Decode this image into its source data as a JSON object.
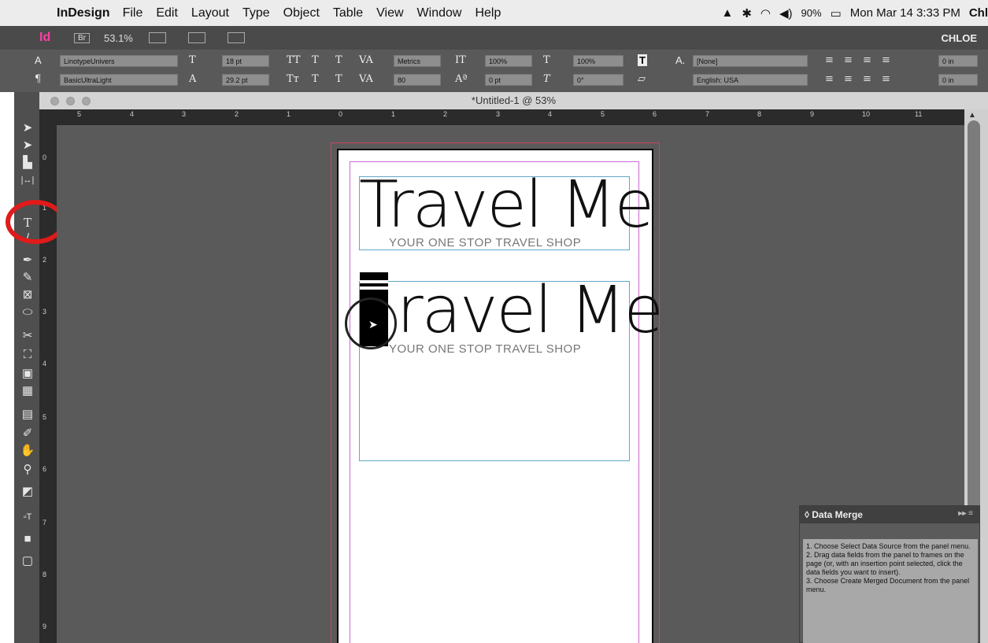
{
  "menubar": {
    "app": "InDesign",
    "items": [
      "File",
      "Edit",
      "Layout",
      "Type",
      "Object",
      "Table",
      "View",
      "Window",
      "Help"
    ],
    "battery": "90%",
    "clock": "Mon Mar 14  3:33 PM",
    "user_trunc": "Chl"
  },
  "appbar": {
    "logo": "Id",
    "bridge": "Br",
    "zoom": "53.1%",
    "user": "CHLOE"
  },
  "control": {
    "font_family": "LinotypeUnivers",
    "font_style": "BasicUltraLight",
    "font_size": "18 pt",
    "leading": "29.2 pt",
    "kerning": "Metrics",
    "tracking": "80",
    "vscale": "100%",
    "hscale": "100%",
    "baseline": "0 pt",
    "skew": "0°",
    "char_style": "[None]",
    "language": "English: USA",
    "indent_left": "0 in",
    "indent_first": "0 in"
  },
  "document": {
    "title": "*Untitled-1 @ 53%"
  },
  "ruler": {
    "h_numbers": [
      "5",
      "4",
      "3",
      "2",
      "1",
      "0",
      "1",
      "2",
      "3",
      "4",
      "5",
      "6",
      "7",
      "8",
      "9",
      "10",
      "11"
    ],
    "v_numbers": [
      "0",
      "1",
      "2",
      "3",
      "4",
      "5",
      "6",
      "7",
      "8",
      "9"
    ]
  },
  "page": {
    "heading1": "Travel Me",
    "tagline1": "YOUR ONE STOP TRAVEL SHOP",
    "heading2": "ravel Me",
    "tagline2": "YOUR ONE STOP TRAVEL SHOP"
  },
  "data_merge": {
    "title": "Data Merge",
    "instructions": "1. Choose Select Data Source from the panel menu.\n2. Drag data fields from the panel to frames on the page (or, with an insertion point selected, click the data fields you want to insert).\n3. Choose Create Merged Document from the panel menu."
  },
  "colors": {
    "highlight_ring": "#e11a1a",
    "frame_edge": "#5fa8c8",
    "margin_guide": "#c86ad1",
    "bleed_guide": "#c9475a"
  }
}
